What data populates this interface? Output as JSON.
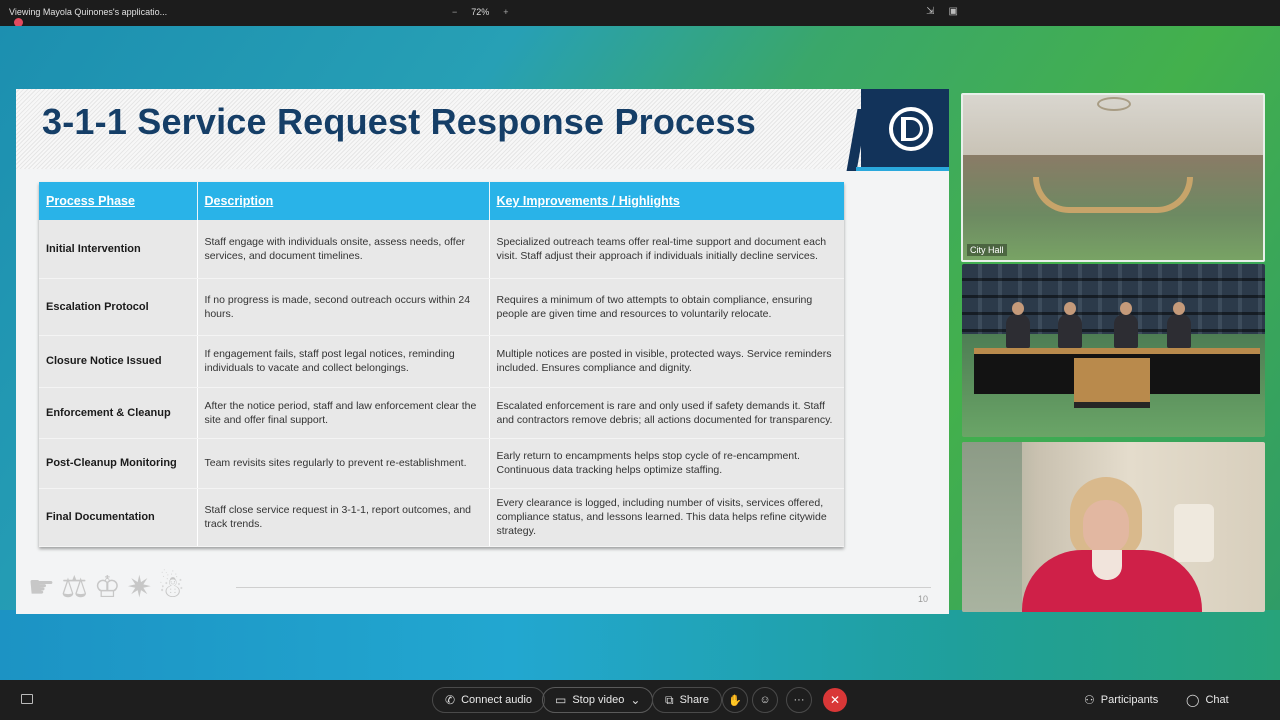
{
  "topbar": {
    "title": "Viewing Mayola Quinones's applicatio...",
    "zoom_minus": "−",
    "zoom_value": "72%",
    "zoom_plus": "+"
  },
  "slide": {
    "title": "3-1-1 Service Request Response Process",
    "page_number": "10",
    "columns": [
      "Process Phase",
      "Description",
      "Key Improvements / Highlights"
    ],
    "rows": [
      {
        "phase": "Initial Intervention",
        "description": "Staff engage with individuals onsite, assess needs, offer services, and document timelines.",
        "highlights": "Specialized outreach teams offer real-time support and document each visit. Staff adjust their approach if individuals initially decline services."
      },
      {
        "phase": "Escalation Protocol",
        "description": "If no progress is made, second outreach occurs within 24 hours.",
        "highlights": "Requires a minimum of two attempts to obtain compliance, ensuring people are given time and resources to voluntarily relocate."
      },
      {
        "phase": "Closure Notice Issued",
        "description": "If engagement fails, staff post legal notices, reminding individuals to vacate and collect belongings.",
        "highlights": "Multiple notices are posted in visible, protected ways. Service reminders included. Ensures compliance and dignity."
      },
      {
        "phase": "Enforcement & Cleanup",
        "description": "After the notice period, staff and law enforcement clear the site and offer final support.",
        "highlights": "Escalated enforcement is rare and only used if safety demands it. Staff and contractors remove debris; all actions documented for transparency."
      },
      {
        "phase": "Post-Cleanup Monitoring",
        "description": "Team revisits sites regularly to prevent re-establishment.",
        "highlights": "Early return to encampments helps stop cycle of re-encampment. Continuous data tracking helps optimize staffing."
      },
      {
        "phase": "Final Documentation",
        "description": "Staff close service request in 3-1-1, report outcomes, and track trends.",
        "highlights": "Every clearance is logged, including number of visits, services offered, compliance status, and lessons learned. This data helps refine citywide strategy."
      }
    ]
  },
  "videos": {
    "tile1_label": "City Hall"
  },
  "toolbar": {
    "connect_audio": "Connect audio",
    "stop_video": "Stop video",
    "share": "Share",
    "more": "···",
    "participants": "Participants",
    "chat": "Chat"
  },
  "colors": {
    "header_blue": "#29b3e8",
    "title_navy": "#153e67",
    "end_red": "#d93737"
  }
}
